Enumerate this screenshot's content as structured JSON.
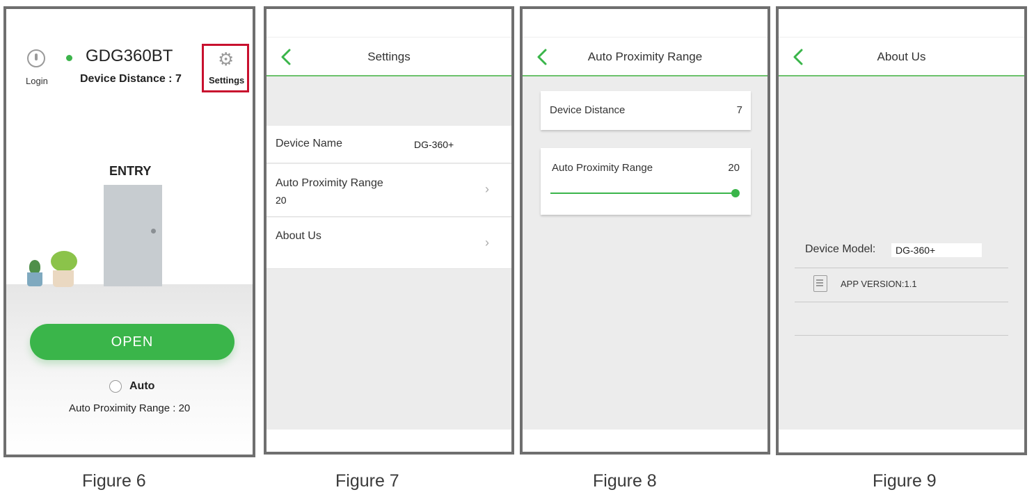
{
  "figure6": {
    "caption": "Figure 6",
    "login_label": "Login",
    "device_title": "GDG360BT",
    "device_distance": "Device Distance : 7",
    "settings_label": "Settings",
    "entry_label": "ENTRY",
    "open_label": "OPEN",
    "auto_label": "Auto",
    "auto_range": "Auto Proximity Range : 20",
    "auto_checked": false,
    "status_color": "#3cb44b",
    "button_color": "#3ab54a",
    "highlight_color": "#c8102e",
    "icons": [
      "login-icon",
      "gear-icon"
    ]
  },
  "figure7": {
    "caption": "Figure 7",
    "title": "Settings",
    "rows": [
      {
        "label": "Device Name",
        "value": "DG-360+"
      },
      {
        "label": "Auto Proximity Range",
        "value": "20"
      },
      {
        "label": "About Us",
        "value": ""
      }
    ]
  },
  "figure8": {
    "caption": "Figure 8",
    "title": "Auto Proximity Range",
    "device_distance_label": "Device Distance",
    "device_distance_value": "7",
    "range_label": "Auto Proximity Range",
    "range_value": "20",
    "slider_fraction": 1.0,
    "accent_color": "#3ab54a"
  },
  "figure9": {
    "caption": "Figure 9",
    "title": "About Us",
    "device_model_label": "Device Model:",
    "device_model_value": "DG-360+",
    "app_version": "APP VERSION:1.1"
  }
}
